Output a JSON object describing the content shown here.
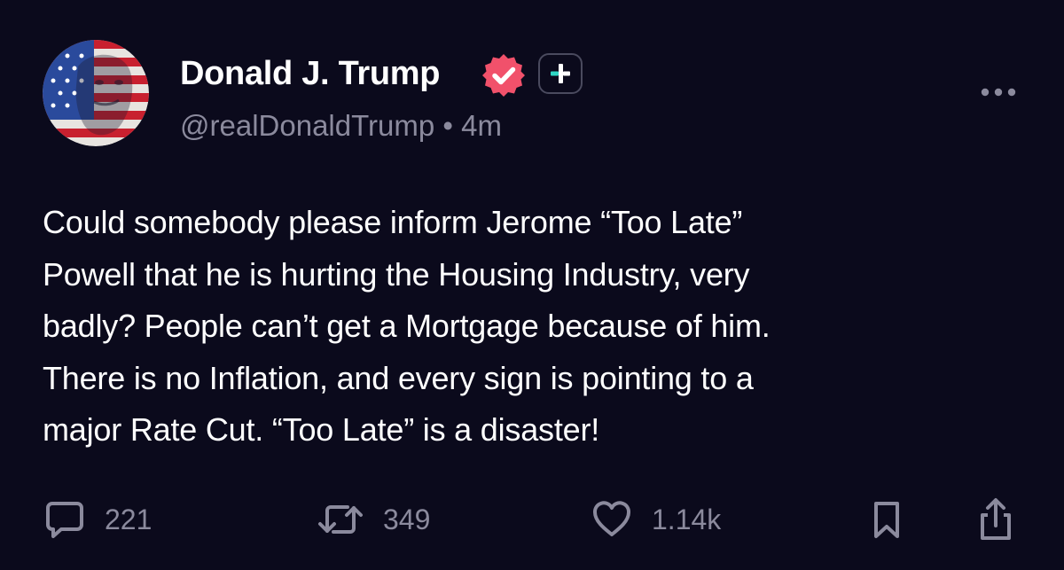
{
  "post": {
    "author": {
      "display_name": "Donald J. Trump",
      "handle": "@realDonaldTrump",
      "time": "4m",
      "separator": "•"
    },
    "text": "Could somebody please inform Jerome “Too Late”\nPowell that he is hurting the Housing Industry, very\nbadly? People can’t get a Mortgage because of him.\nThere is no Inflation, and every sign is pointing to a\nmajor Rate Cut. “Too Late” is a disaster!",
    "stats": {
      "replies": "221",
      "reposts": "349",
      "likes": "1.14k"
    }
  },
  "icons": {
    "verified": "verified-badge-icon",
    "follow": "plus-icon",
    "more": "more-dots-icon",
    "reply": "comment-icon",
    "repost": "repost-icon",
    "like": "heart-icon",
    "bookmark": "bookmark-icon",
    "share": "share-icon"
  },
  "colors": {
    "background": "#0b0a1c",
    "text_primary": "#ffffff",
    "text_secondary": "#8b8a9d",
    "verified_badge": "#f1516b",
    "follow_plus_accent": "#2ed6c4"
  }
}
